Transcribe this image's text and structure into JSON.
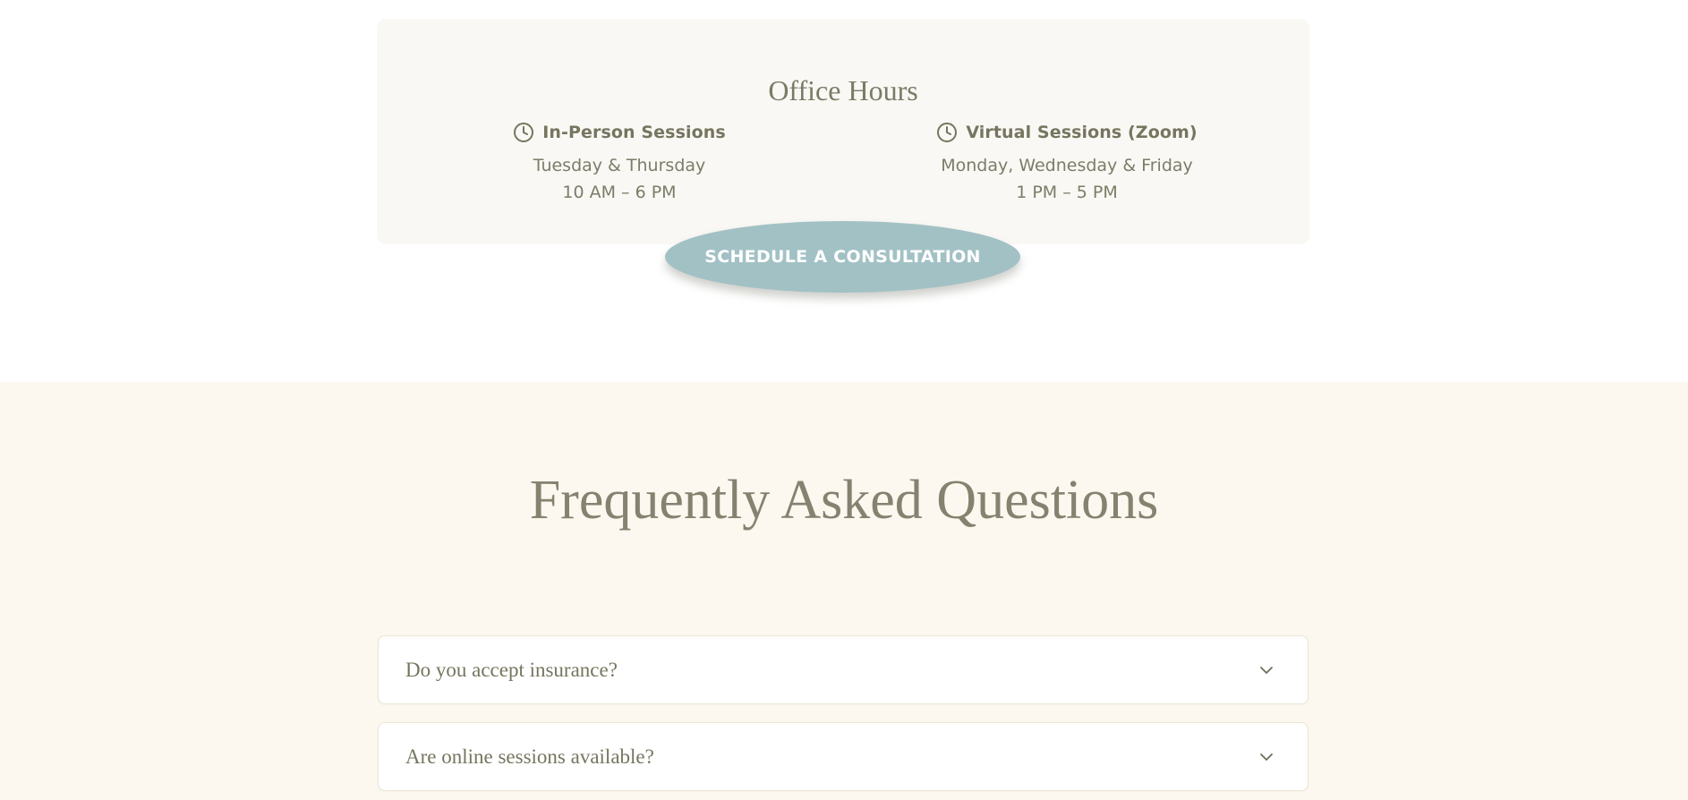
{
  "office_hours": {
    "title": "Office Hours",
    "in_person": {
      "heading": "In-Person Sessions",
      "icon": "clock-icon",
      "days": "Tuesday & Thursday",
      "time": "10 AM – 6 PM"
    },
    "virtual": {
      "heading": "Virtual Sessions (Zoom)",
      "icon": "clock-icon",
      "days": "Monday, Wednesday & Friday",
      "time": "1 PM – 5 PM"
    },
    "cta_label": "SCHEDULE A CONSULTATION"
  },
  "faq": {
    "title": "Frequently Asked Questions",
    "items": [
      {
        "question": "Do you accept insurance?",
        "icon": "chevron-down-icon"
      },
      {
        "question": "Are online sessions available?",
        "icon": "chevron-down-icon"
      }
    ]
  },
  "colors": {
    "text": "#7b7a66",
    "card_background": "#f9f8f4",
    "faq_background": "#fcf8ef",
    "button": "#a2c1c5",
    "button_text": "#ffffff"
  }
}
